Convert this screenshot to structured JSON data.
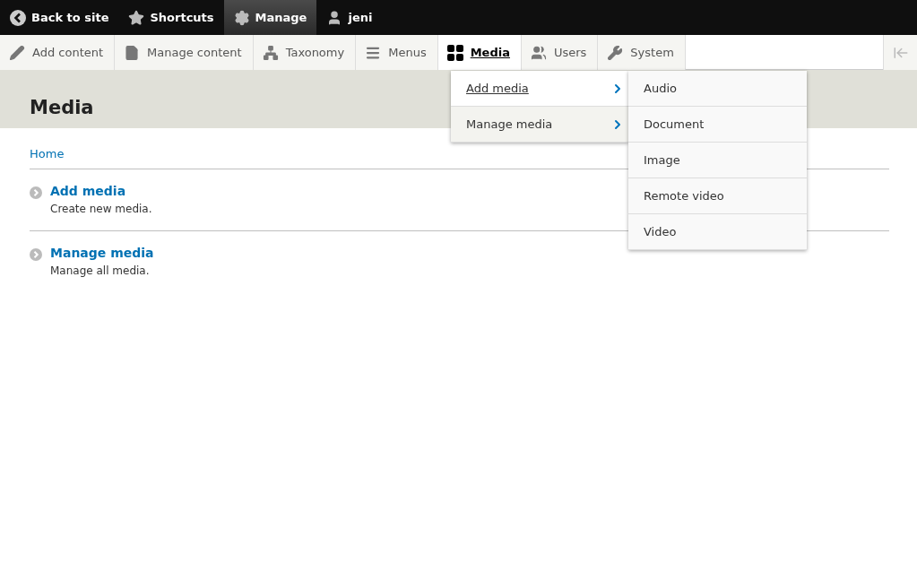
{
  "top_bar": {
    "items": [
      {
        "label": "Back to site",
        "selected": false
      },
      {
        "label": "Shortcuts",
        "selected": false
      },
      {
        "label": "Manage",
        "selected": true
      },
      {
        "label": "jeni",
        "selected": false
      }
    ]
  },
  "tray": {
    "items": [
      {
        "label": "Add content",
        "selected": false
      },
      {
        "label": "Manage content",
        "selected": false
      },
      {
        "label": "Taxonomy",
        "selected": false
      },
      {
        "label": "Menus",
        "selected": false
      },
      {
        "label": "Media",
        "selected": true
      },
      {
        "label": "Users",
        "selected": false
      },
      {
        "label": "System",
        "selected": false
      }
    ]
  },
  "menu": {
    "items": [
      {
        "label": "Add media",
        "selected": true
      },
      {
        "label": "Manage media",
        "selected": false
      }
    ]
  },
  "submenu": {
    "items": [
      "Audio",
      "Document",
      "Image",
      "Remote video",
      "Video"
    ]
  },
  "page": {
    "title": "Media",
    "breadcrumb": "Home",
    "links": [
      {
        "title": "Add media",
        "description": "Create new media."
      },
      {
        "title": "Manage media",
        "description": "Manage all media."
      }
    ]
  }
}
